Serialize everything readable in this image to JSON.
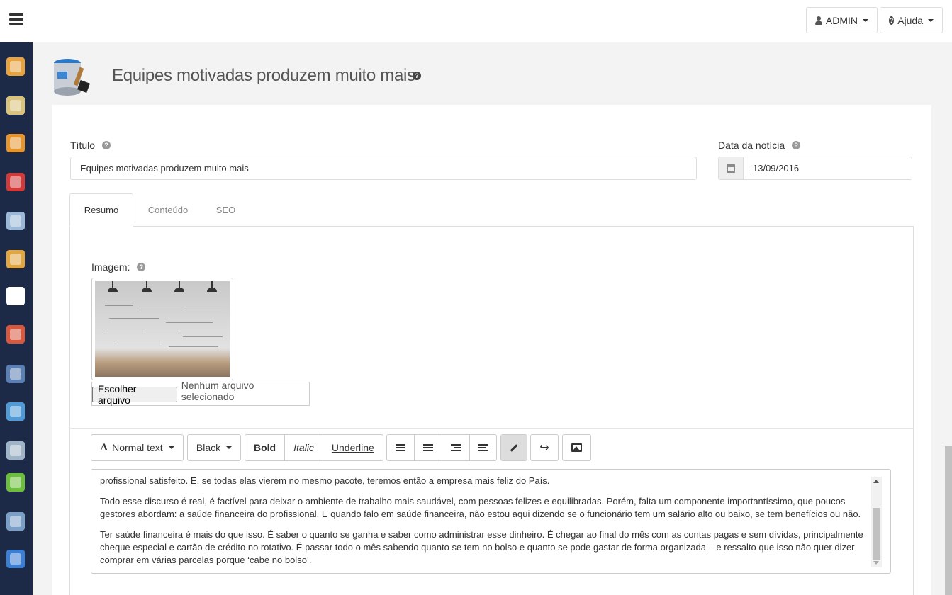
{
  "topbar": {
    "admin_label": "ADMIN",
    "help_label": "Ajuda"
  },
  "sidebar": {
    "items": [
      {
        "icon": "box-icon",
        "color": "#e8a33c"
      },
      {
        "icon": "products-icon",
        "color": "#d9c27a"
      },
      {
        "icon": "package-icon",
        "color": "#e6952c"
      },
      {
        "icon": "discount-icon",
        "color": "#d23a3a"
      },
      {
        "icon": "card-icon",
        "color": "#9ab8d8"
      },
      {
        "icon": "truck-icon",
        "color": "#e2a640"
      },
      {
        "icon": "document-icon",
        "color": "#ffffff"
      },
      {
        "icon": "users-icon",
        "color": "#d8573d"
      },
      {
        "icon": "person-icon",
        "color": "#5a7fb3"
      },
      {
        "icon": "image-icon",
        "color": "#4f9bd8"
      },
      {
        "icon": "database-icon",
        "color": "#a0b4c8"
      },
      {
        "icon": "chart-icon",
        "color": "#6cbf3a"
      },
      {
        "icon": "settings-icon",
        "color": "#7aa0c8"
      },
      {
        "icon": "help-icon",
        "color": "#3b7fd4"
      }
    ]
  },
  "page": {
    "title": "Equipes motivadas produzem muito mais"
  },
  "form": {
    "title_label": "Título",
    "title_value": "Equipes motivadas produzem muito mais",
    "date_label": "Data da notícia",
    "date_value": "13/09/2016"
  },
  "tabs": [
    {
      "label": "Resumo",
      "active": true
    },
    {
      "label": "Conteúdo",
      "active": false
    },
    {
      "label": "SEO",
      "active": false
    }
  ],
  "image_field": {
    "label": "Imagem:",
    "file_button": "Escolher arquivo",
    "file_status": "Nenhum arquivo selecionado"
  },
  "toolbar": {
    "font_size": "Normal text",
    "color": "Black",
    "bold": "Bold",
    "italic": "Italic",
    "underline": "Underline"
  },
  "editor": {
    "paragraphs": [
      "profissional satisfeito. E, se todas elas vierem no mesmo pacote, teremos então a empresa mais feliz do País.",
      "Todo esse discurso é real, é factível para deixar o ambiente de trabalho mais saudável, com pessoas felizes e equilibradas. Porém, falta um componente importantíssimo, que poucos gestores abordam: a saúde financeira do profissional. E quando falo em saúde financeira, não estou aqui dizendo se o funcionário tem um salário alto ou baixo, se tem benefícios ou não.",
      "Ter saúde financeira é mais do que isso. É saber o quanto se ganha e saber como administrar esse dinheiro. É chegar ao final do mês com as contas pagas e sem dívidas, principalmente cheque especial e cartão de crédito no rotativo. É passar todo o mês sabendo quanto se tem no bolso e quanto se pode gastar de forma organizada – e ressalto que isso não quer dizer comprar em várias parcelas porque ‘cabe no bolso’."
    ]
  }
}
